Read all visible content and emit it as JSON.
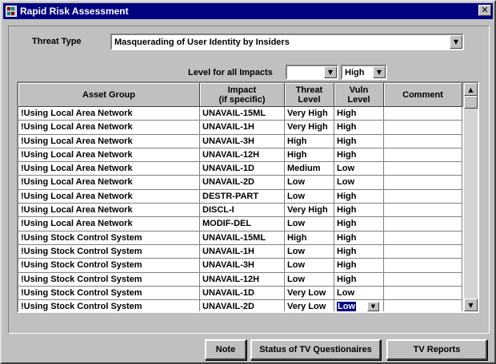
{
  "window": {
    "title": "Rapid Risk Assessment",
    "close_glyph": "✕"
  },
  "threat": {
    "label": "Threat Type",
    "value": "Masquerading of User Identity by Insiders"
  },
  "impacts": {
    "label": "Level for all Impacts",
    "first_value": "",
    "second_value": "High"
  },
  "table": {
    "headers": [
      {
        "line1": "Asset Group",
        "line2": ""
      },
      {
        "line1": "Impact",
        "line2": "(if specific)"
      },
      {
        "line1": "Threat",
        "line2": "Level"
      },
      {
        "line1": "Vuln",
        "line2": "Level"
      },
      {
        "line1": "Comment",
        "line2": ""
      }
    ],
    "rows": [
      [
        "!Using Local Area Network",
        "UNAVAIL-15ML",
        "Very High",
        "High",
        ""
      ],
      [
        "!Using Local Area Network",
        "UNAVAIL-1H",
        "Very High",
        "High",
        ""
      ],
      [
        "!Using Local Area Network",
        "UNAVAIL-3H",
        "High",
        "High",
        ""
      ],
      [
        "!Using Local Area Network",
        "UNAVAIL-12H",
        "High",
        "High",
        ""
      ],
      [
        "!Using Local Area Network",
        "UNAVAIL-1D",
        "Medium",
        "Low",
        ""
      ],
      [
        "!Using Local Area Network",
        "UNAVAIL-2D",
        "Low",
        "Low",
        ""
      ],
      [
        "!Using Local Area Network",
        "DESTR-PART",
        "Low",
        "High",
        ""
      ],
      [
        "!Using Local Area Network",
        "DISCL-I",
        "Very High",
        "High",
        ""
      ],
      [
        "!Using Local Area Network",
        "MODIF-DEL",
        "Low",
        "High",
        ""
      ],
      [
        "!Using Stock Control System",
        "UNAVAIL-15ML",
        "High",
        "High",
        ""
      ],
      [
        "!Using Stock Control System",
        "UNAVAIL-1H",
        "Low",
        "High",
        ""
      ],
      [
        "!Using Stock Control System",
        "UNAVAIL-3H",
        "Low",
        "High",
        ""
      ],
      [
        "!Using Stock Control System",
        "UNAVAIL-12H",
        "Low",
        "High",
        ""
      ],
      [
        "!Using Stock Control System",
        "UNAVAIL-1D",
        "Very Low",
        "Low",
        ""
      ],
      [
        "!Using Stock Control System",
        "UNAVAIL-2D",
        "Very Low",
        "Low",
        ""
      ]
    ],
    "selected_row": 14
  },
  "buttons": {
    "note": "Note",
    "status": "Status of TV Questionaires",
    "reports": "TV Reports"
  },
  "icons": {
    "dropdown": "chevron-down-icon",
    "scroll_up": "arrow-up-icon",
    "scroll_down": "arrow-down-icon"
  },
  "colors": {
    "title_bar": "#000080",
    "face": "#c0c0c0",
    "selection": "#000080"
  }
}
